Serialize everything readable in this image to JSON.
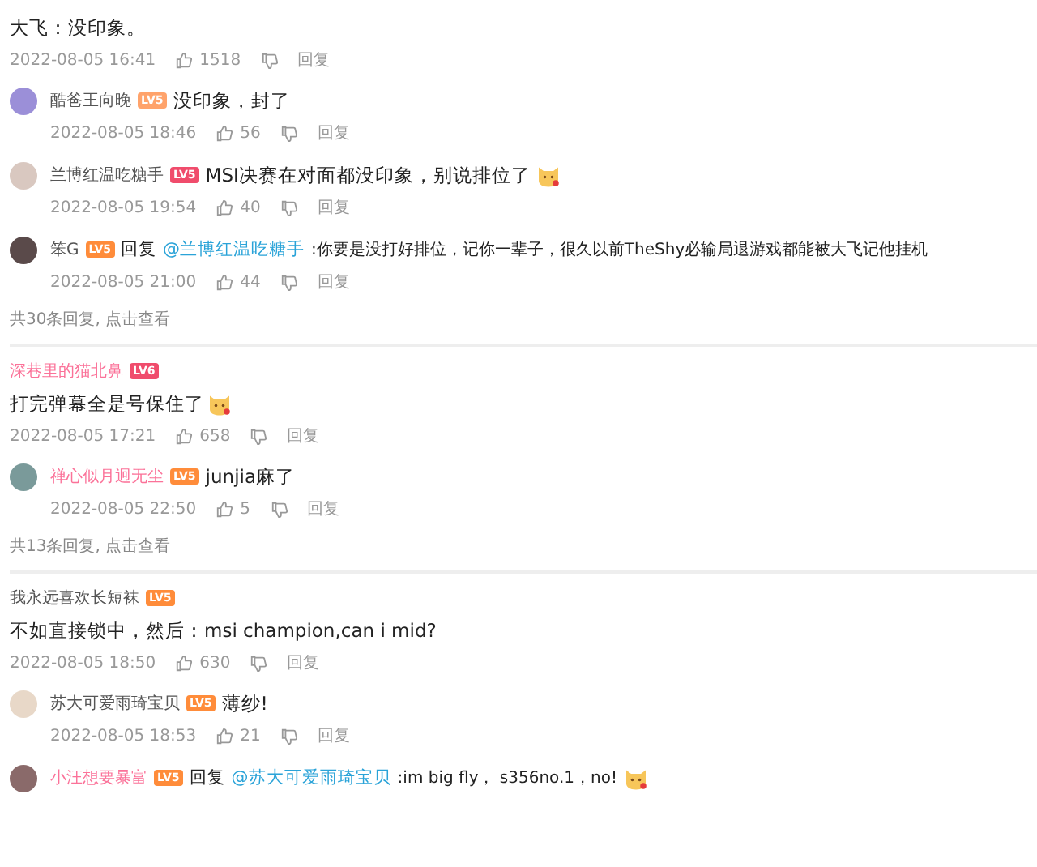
{
  "threads": [
    {
      "text": "大飞：没印象。",
      "emoji": false,
      "time": "2022-08-05 16:41",
      "likes": "1518",
      "reply_label": "回复",
      "replies": [
        {
          "author": {
            "name": "酷爸王向晚",
            "vip": false,
            "color": "#9b8fd8",
            "badge": {
              "text": "LV5",
              "color": "#ffa36b"
            }
          },
          "text": "没印象，封了",
          "emoji": false,
          "time": "2022-08-05 18:46",
          "likes": "56",
          "reply_label": "回复"
        },
        {
          "author": {
            "name": "兰博红温吃糖手",
            "vip": false,
            "color": "#d9c8c0",
            "badge": {
              "text": "LV5",
              "color": "#f04c6c"
            }
          },
          "text": "MSI决赛在对面都没印象，别说排位了",
          "emoji": true,
          "time": "2022-08-05 19:54",
          "likes": "40",
          "reply_label": "回复"
        },
        {
          "author": {
            "name": "笨G",
            "vip": false,
            "color": "#5a4a4a",
            "badge": {
              "text": "LV5",
              "color": "#ff8c3a"
            }
          },
          "reply_to": {
            "prefix": "回复",
            "name": "@兰博红温吃糖手"
          },
          "text": ":你要是没打好排位，记你一辈子，很久以前TheShy必输局退游戏都能被大飞记他挂机",
          "emoji": false,
          "time": "2022-08-05 21:00",
          "likes": "44",
          "reply_label": "回复"
        }
      ],
      "footer": "共30条回复, 点击查看"
    },
    {
      "author": {
        "name": "深巷里的猫北鼻",
        "vip": true,
        "badge": {
          "text": "LV6",
          "color": "#f04c6c"
        }
      },
      "text": "打完弹幕全是号保住了",
      "emoji": true,
      "time": "2022-08-05 17:21",
      "likes": "658",
      "reply_label": "回复",
      "replies": [
        {
          "author": {
            "name": "禅心似月迥无尘",
            "vip": true,
            "color": "#7a9a9a",
            "badge": {
              "text": "LV5",
              "color": "#ff8c3a"
            }
          },
          "text": "junjia麻了",
          "emoji": false,
          "time": "2022-08-05 22:50",
          "likes": "5",
          "reply_label": "回复"
        }
      ],
      "footer": "共13条回复, 点击查看"
    },
    {
      "author": {
        "name": "我永远喜欢长短袜",
        "vip": false,
        "badge": {
          "text": "LV5",
          "color": "#ff8c3a"
        }
      },
      "text": "不如直接锁中，然后：msi champion,can i mid?",
      "emoji": false,
      "time": "2022-08-05 18:50",
      "likes": "630",
      "reply_label": "回复",
      "replies": [
        {
          "author": {
            "name": "苏大可爱雨琦宝贝",
            "vip": false,
            "color": "#e8d8c8",
            "badge": {
              "text": "LV5",
              "color": "#ff8c3a"
            }
          },
          "text": "薄纱!",
          "emoji": false,
          "time": "2022-08-05 18:53",
          "likes": "21",
          "reply_label": "回复"
        },
        {
          "author": {
            "name": "小汪想要暴富",
            "vip": true,
            "color": "#8a6a6a",
            "badge": {
              "text": "LV5",
              "color": "#ff8c3a"
            }
          },
          "reply_to": {
            "prefix": "回复",
            "name": "@苏大可爱雨琦宝贝"
          },
          "text": ":im big fly， s356no.1，no!",
          "emoji": true
        }
      ]
    }
  ]
}
